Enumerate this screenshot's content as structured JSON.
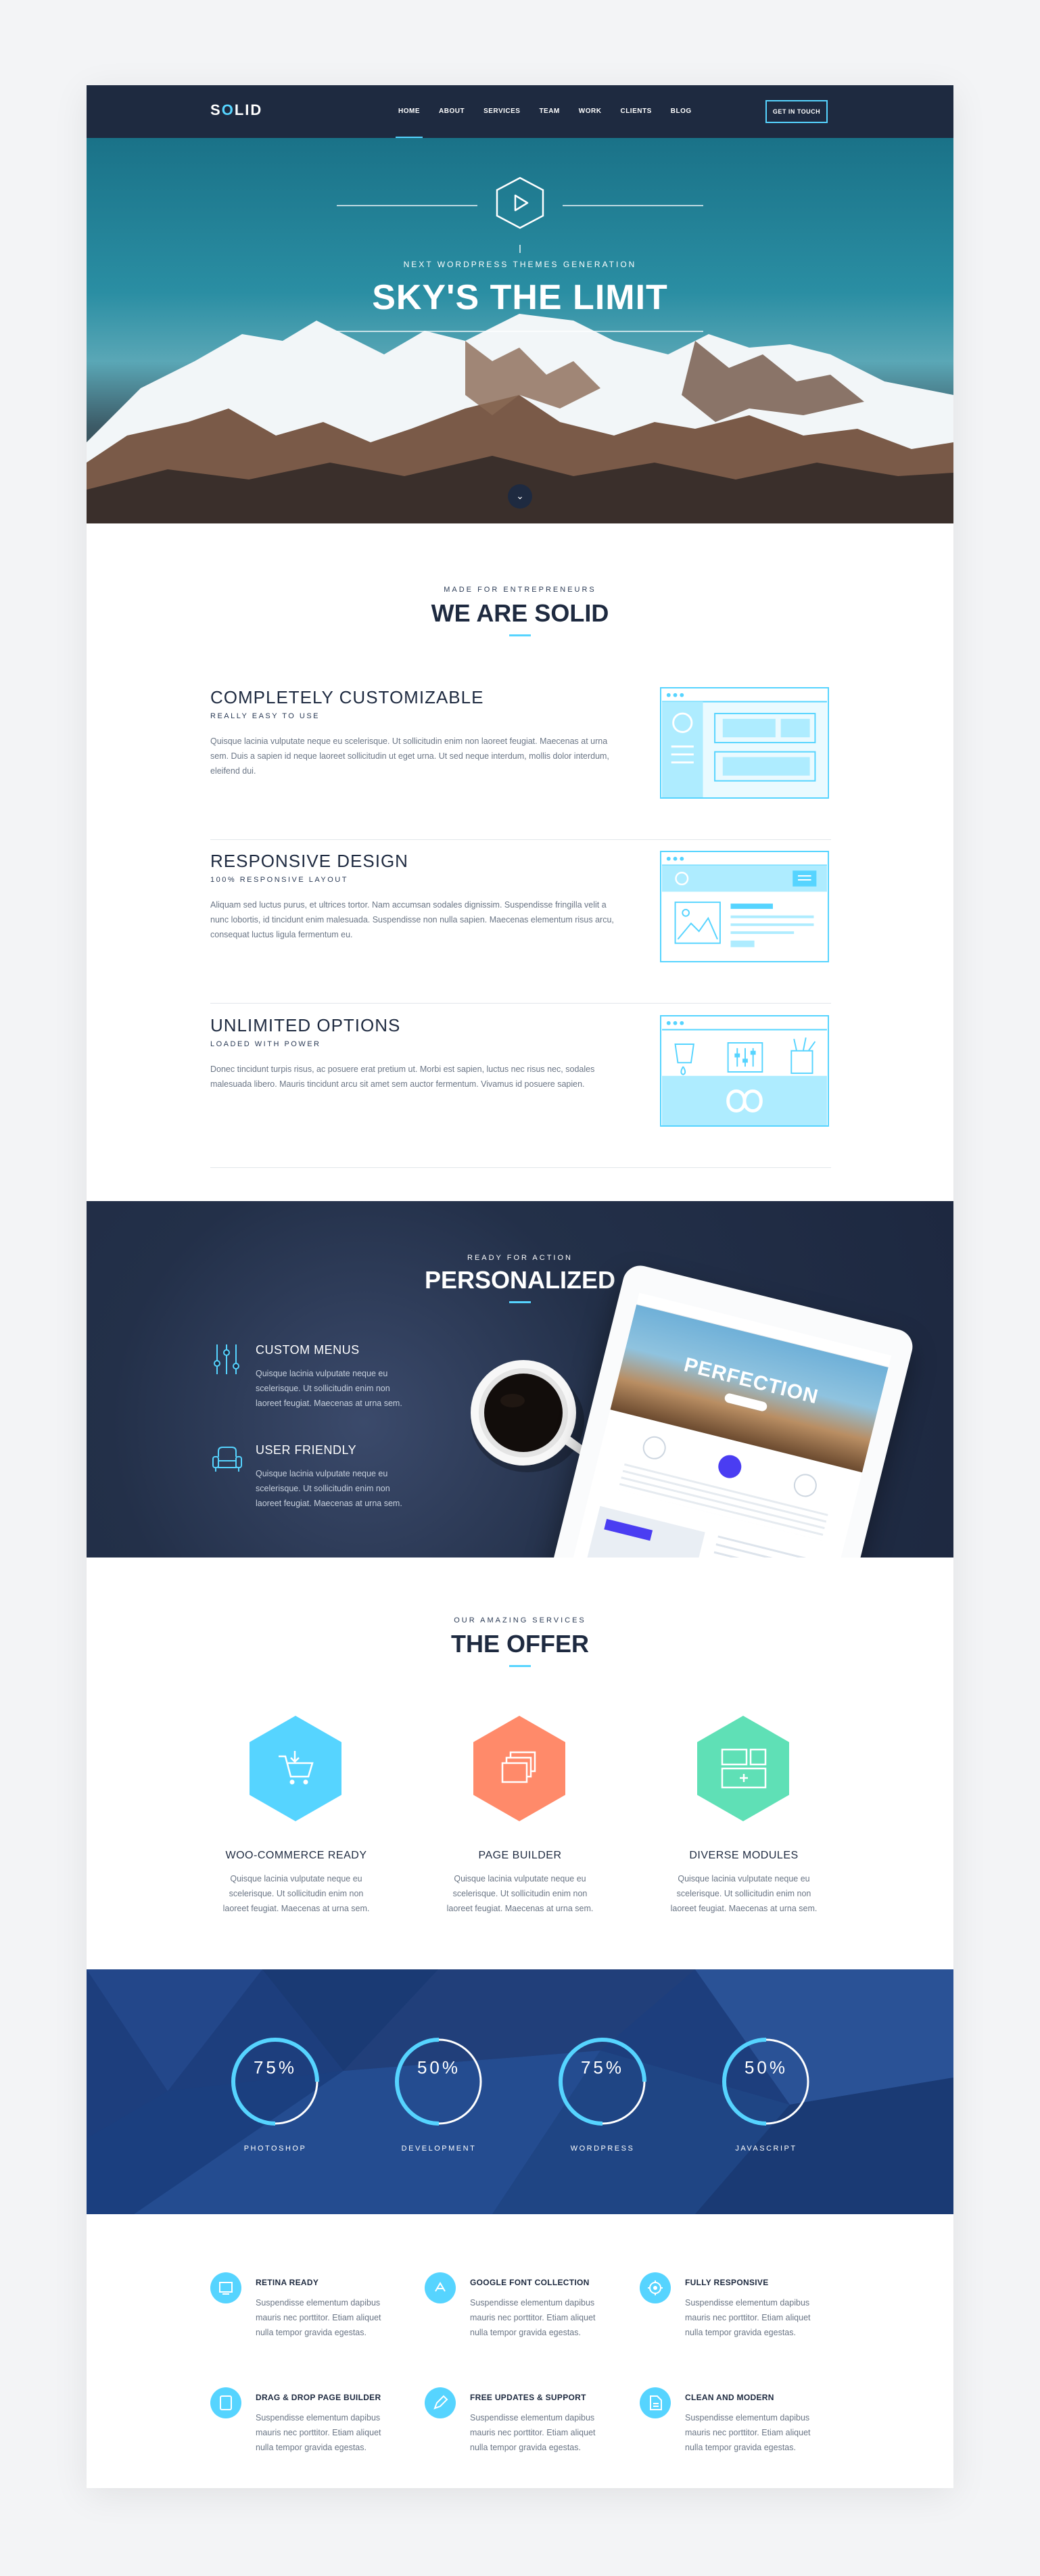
{
  "nav": {
    "logo_s": "S",
    "logo_o": "O",
    "logo_rest": "LID",
    "items": [
      "HOME",
      "ABOUT",
      "SERVICES",
      "TEAM",
      "WORK",
      "CLIENTS",
      "BLOG"
    ],
    "cta": "GET IN TOUCH"
  },
  "hero": {
    "subtitle": "NEXT WORDPRESS THEMES GENERATION",
    "title": "SKY'S THE LIMIT"
  },
  "about": {
    "subtitle": "MADE FOR ENTREPRENEURS",
    "title": "WE ARE SOLID",
    "features": [
      {
        "title": "COMPLETELY CUSTOMIZABLE",
        "subtitle": "REALLY EASY TO USE",
        "text": "Quisque lacinia vulputate neque eu scelerisque. Ut sollicitudin enim non laoreet feugiat. Maecenas at urna sem. Duis a sapien id neque laoreet sollicitudin ut eget urna. Ut sed neque interdum, mollis dolor interdum, eleifend dui."
      },
      {
        "title": "RESPONSIVE DESIGN",
        "subtitle": "100% RESPONSIVE LAYOUT",
        "text": "Aliquam sed luctus purus, et ultrices tortor. Nam accumsan sodales dignissim. Suspendisse fringilla velit a nunc lobortis, id tincidunt enim malesuada. Suspendisse non nulla sapien. Maecenas elementum risus arcu, consequat luctus ligula fermentum eu."
      },
      {
        "title": "UNLIMITED OPTIONS",
        "subtitle": "LOADED WITH POWER",
        "text": "Donec tincidunt turpis risus, ac posuere erat pretium ut. Morbi est sapien, luctus nec risus nec, sodales malesuada libero. Mauris tincidunt arcu sit amet sem auctor fermentum. Vivamus id posuere sapien."
      }
    ]
  },
  "personalized": {
    "subtitle": "READY FOR ACTION",
    "title": "PERSONALIZED",
    "items": [
      {
        "title": "CUSTOM MENUS",
        "text": "Quisque lacinia vulputate neque eu scelerisque. Ut sollicitudin enim non laoreet feugiat. Maecenas at urna sem."
      },
      {
        "title": "USER FRIENDLY",
        "text": "Quisque lacinia vulputate neque eu scelerisque. Ut sollicitudin enim non laoreet feugiat. Maecenas at urna sem."
      }
    ],
    "tablet_headline": "PERFECTION"
  },
  "offer": {
    "subtitle": "OUR AMAZING SERVICES",
    "title": "THE OFFER",
    "cards": [
      {
        "title": "WOO-COMMERCE READY",
        "text": "Quisque lacinia vulputate neque eu scelerisque. Ut sollicitudin enim non laoreet feugiat. Maecenas at urna sem.",
        "color": "#56d4ff",
        "icon": "cart-icon"
      },
      {
        "title": "PAGE BUILDER",
        "text": "Quisque lacinia vulputate neque eu scelerisque. Ut sollicitudin enim non laoreet feugiat. Maecenas at urna sem.",
        "color": "#ff8a6a",
        "icon": "layers-icon"
      },
      {
        "title": "DIVERSE MODULES",
        "text": "Quisque lacinia vulputate neque eu scelerisque. Ut sollicitudin enim non laoreet feugiat. Maecenas at urna sem.",
        "color": "#5fe0b6",
        "icon": "modules-icon"
      }
    ]
  },
  "stats": [
    {
      "value": "75%",
      "label": "PHOTOSHOP",
      "fraction": 0.75
    },
    {
      "value": "50%",
      "label": "DEVELOPMENT",
      "fraction": 0.5
    },
    {
      "value": "75%",
      "label": "WORDPRESS",
      "fraction": 0.75
    },
    {
      "value": "50%",
      "label": "JAVASCRIPT",
      "fraction": 0.5
    }
  ],
  "perks": [
    {
      "title": "RETINA READY",
      "text": "Suspendisse elementum dapibus mauris nec porttitor. Etiam aliquet nulla tempor gravida egestas."
    },
    {
      "title": "GOOGLE FONT COLLECTION",
      "text": "Suspendisse elementum dapibus mauris nec porttitor. Etiam aliquet nulla tempor gravida egestas."
    },
    {
      "title": "FULLY RESPONSIVE",
      "text": "Suspendisse elementum dapibus mauris nec porttitor. Etiam aliquet nulla tempor gravida egestas."
    },
    {
      "title": "DRAG & DROP PAGE BUILDER",
      "text": "Suspendisse elementum dapibus mauris nec porttitor. Etiam aliquet nulla tempor gravida egestas."
    },
    {
      "title": "FREE UPDATES & SUPPORT",
      "text": "Suspendisse elementum dapibus mauris nec porttitor. Etiam aliquet nulla tempor gravida egestas."
    },
    {
      "title": "CLEAN AND MODERN",
      "text": "Suspendisse elementum dapibus mauris nec porttitor. Etiam aliquet nulla tempor gravida egestas."
    }
  ],
  "colors": {
    "accent": "#56d4ff",
    "navy": "#1e2a40",
    "stats_bg": "#1d3e7d"
  }
}
